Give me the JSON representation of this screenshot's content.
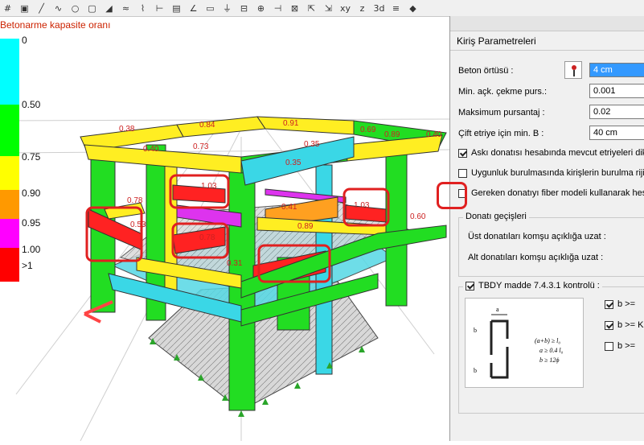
{
  "legend": {
    "title": "Betonarme kapasite oranı",
    "items": [
      {
        "label": "0",
        "color": "#00ffff"
      },
      {
        "label": "0.50",
        "color": "#00ff00"
      },
      {
        "label": "0.75",
        "color": "#ffff00"
      },
      {
        "label": "0.90",
        "color": "#ff9900"
      },
      {
        "label": "0.95",
        "color": "#ff00ff"
      },
      {
        "label": "1.00",
        "color": "#ff0000"
      },
      {
        "label": ">1",
        "color": "#ff0000"
      }
    ]
  },
  "model_labels": [
    "0.38",
    "0.84",
    "0.91",
    "0.69",
    "0.89",
    "0.40",
    "0.73",
    "0.40",
    "0.78",
    "1.03",
    "0.78",
    "0.35",
    "0.60",
    "0.35",
    "0.89",
    "0.31",
    "0.53",
    "0.41",
    "1.03"
  ],
  "dialog": {
    "title": "Kiriş Parametreleri",
    "fields": [
      {
        "label": "Beton örtüsü :",
        "value": "4 cm"
      },
      {
        "label": "Min. açk. çekme purs.:",
        "value": "0.001"
      },
      {
        "label": "Maksimum pursantaj :",
        "value": "0.02"
      },
      {
        "label": "Çift etriye için min. B :",
        "value": "40 cm"
      }
    ],
    "checkboxes": [
      {
        "label": "Askı donatısı hesabında mevcut etriyeleri dikk",
        "checked": true
      },
      {
        "label": "Uygunluk burulmasında kirişlerin burulma rijitlic",
        "checked": false
      },
      {
        "label": "Gereken donatıyı fiber modeli kullanarak hesa",
        "checked": false
      }
    ],
    "donati_group": {
      "title": "Donatı geçişleri",
      "ust": "Üst donatıları komşu açıklığa uzat :",
      "alt": "Alt donatıları komşu açıklığa uzat :"
    },
    "tbdy": {
      "label": "TBDY madde 7.4.3.1 kontrolü :",
      "checked": true,
      "options": [
        {
          "label": "b >=",
          "checked": true
        },
        {
          "label": "b >= K",
          "checked": true
        },
        {
          "label": "b >=",
          "checked": false
        }
      ],
      "formula": [
        "(a+b) ≥ l₀",
        "a ≥ 0.4 l₀",
        "b ≥ 12ϕ"
      ],
      "dim_a": "a",
      "dim_b": "b"
    }
  },
  "colors": {
    "accent": "#e02020",
    "selection": "#3399ff"
  }
}
